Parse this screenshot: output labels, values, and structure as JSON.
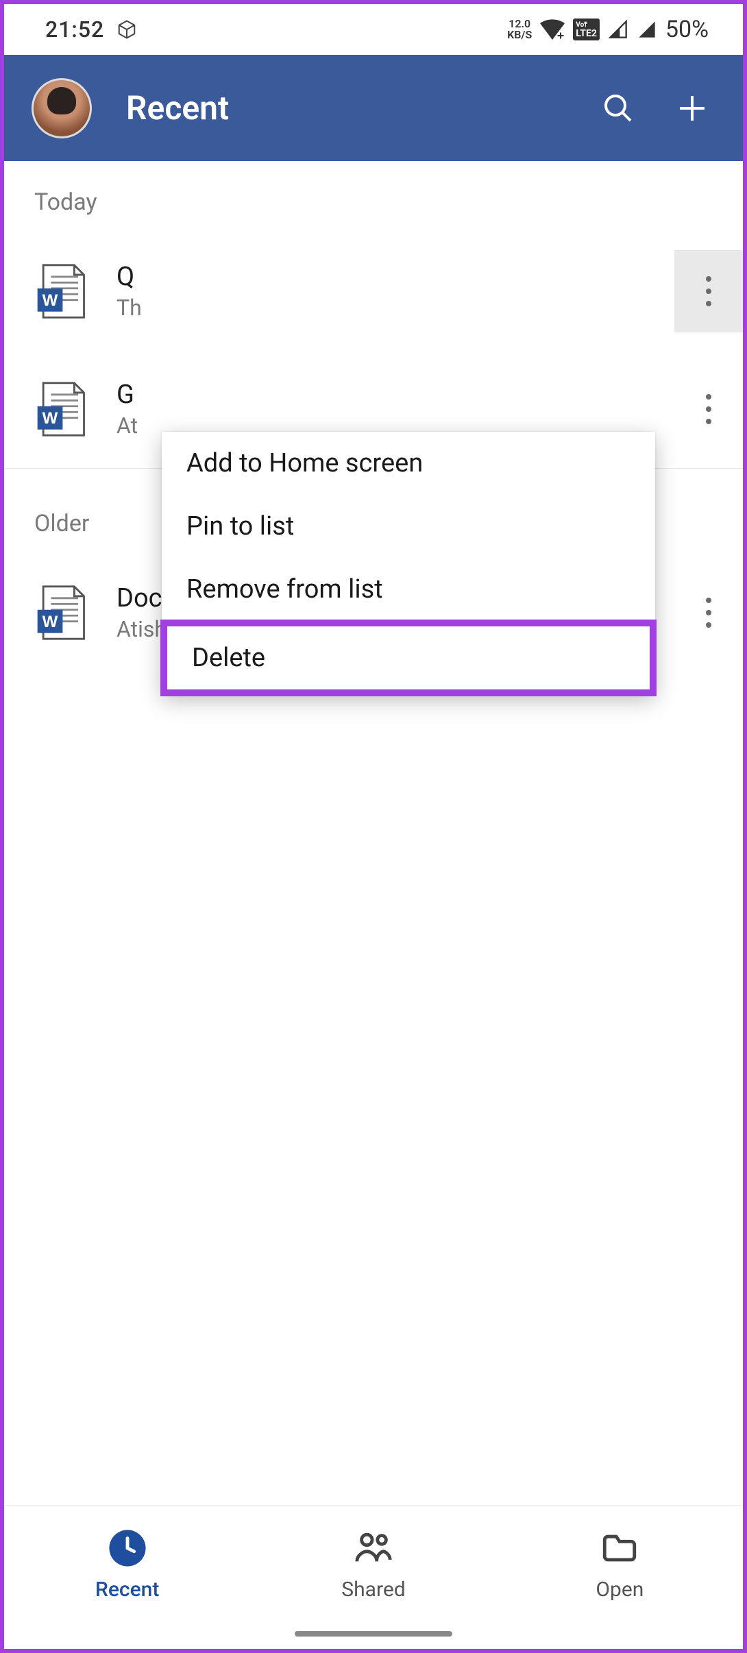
{
  "status": {
    "time": "21:52",
    "net_speed_top": "12.0",
    "net_speed_bottom": "KB/S",
    "volte_text": "LTE2",
    "battery": "50%"
  },
  "header": {
    "title": "Recent"
  },
  "sections": {
    "today": "Today",
    "older": "Older"
  },
  "files": {
    "f1": {
      "name": "Q",
      "path": "Th"
    },
    "f2": {
      "name": "G",
      "path": "At"
    },
    "f3": {
      "name": "Document",
      "path": "Atish Rajasekharan's…eDrive » Documents"
    }
  },
  "menu": {
    "add_home": "Add to Home screen",
    "pin": "Pin to list",
    "remove": "Remove from list",
    "delete": "Delete"
  },
  "nav": {
    "recent": "Recent",
    "shared": "Shared",
    "open": "Open"
  }
}
